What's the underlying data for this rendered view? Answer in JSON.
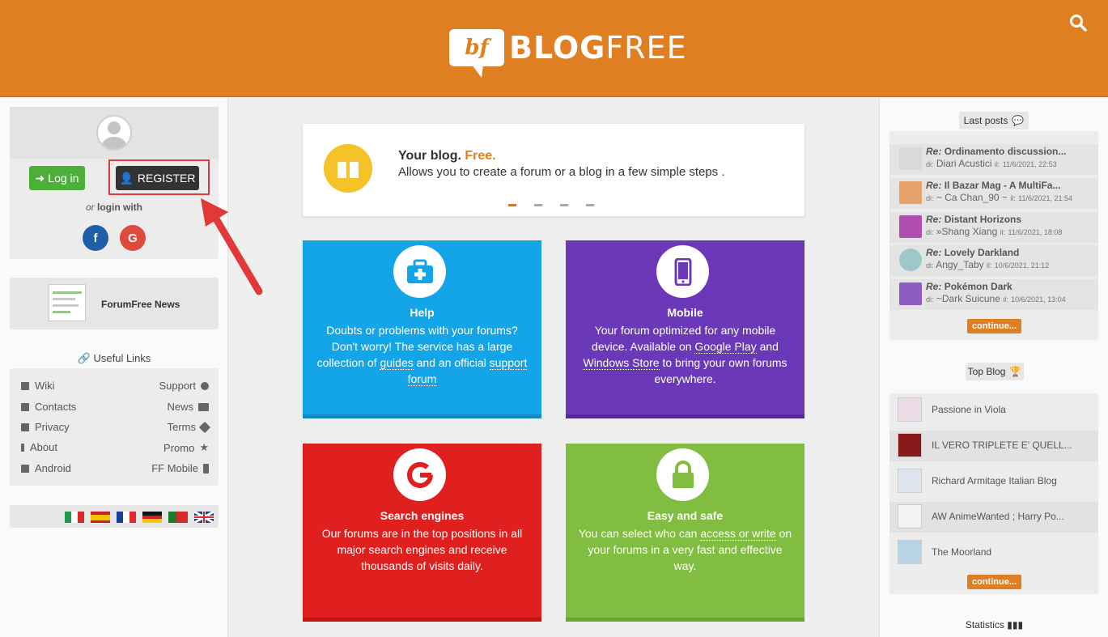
{
  "header": {
    "logo_mark": "bf",
    "logo_bold": "BLOG",
    "logo_light": "FREE",
    "search_icon": "search-icon"
  },
  "login": {
    "login_label": "Log in",
    "register_label": "REGISTER",
    "or_text": "or",
    "login_with": "login with",
    "facebook": "f",
    "google": "G"
  },
  "news": {
    "label": "ForumFree News"
  },
  "useful_links": {
    "title": "Useful Links",
    "left": [
      {
        "label": "Wiki",
        "icon": "book-icon"
      },
      {
        "label": "Contacts",
        "icon": "envelope-icon"
      },
      {
        "label": "Privacy",
        "icon": "lock-icon"
      },
      {
        "label": "About",
        "icon": "info-icon"
      },
      {
        "label": "Android",
        "icon": "android-icon"
      }
    ],
    "right": [
      {
        "label": "Support",
        "icon": "lifebuoy-icon"
      },
      {
        "label": "News",
        "icon": "newspaper-icon"
      },
      {
        "label": "Terms",
        "icon": "gavel-icon"
      },
      {
        "label": "Promo",
        "icon": "star-icon"
      },
      {
        "label": "FF Mobile",
        "icon": "mobile-icon"
      }
    ]
  },
  "hero": {
    "title": "Your blog.",
    "title_accent": "Free.",
    "subtitle": "Allows you to create a forum or a blog in a few simple steps ."
  },
  "cards": {
    "help": {
      "title": "Help",
      "t1": "Doubts or problems with your forums? Don't worry! The service has a large collection of ",
      "link1": "guides",
      "t2": " and an official ",
      "link2": "support forum"
    },
    "mobile": {
      "title": "Mobile",
      "t1": "Your forum optimized for any mobile device. Available on ",
      "link1": "Google Play",
      "t2": " and ",
      "link2": "Windows Store",
      "t3": " to bring your own forums everywhere."
    },
    "search": {
      "title": "Search engines",
      "text": "Our forums are in the top positions in all major search engines and receive thousands of visits daily."
    },
    "safe": {
      "title": "Easy and safe",
      "t1": "You can select who can ",
      "link1": "access or write",
      "t2": " on your forums in a very fast and effective way."
    }
  },
  "last_posts": {
    "title": "Last posts",
    "posts": [
      {
        "re": "Re:",
        "title": "Ordinamento discussion...",
        "by": "di:",
        "author": "Diari Acustici",
        "on": "il:",
        "date": "11/6/2021, 22:53",
        "color": "#cfcfcf"
      },
      {
        "re": "Re:",
        "title": "Il Bazar Mag - A MultiFa...",
        "by": "di:",
        "author": "~ Ca Chan_90 ~",
        "on": "il:",
        "date": "11/6/2021, 21:54",
        "color": "#e9a16a"
      },
      {
        "re": "Re:",
        "title": "Distant Horizons",
        "by": "di:",
        "author": "»Shang Xiang",
        "on": "il:",
        "date": "11/6/2021, 18:08",
        "color": "#b04fb0"
      },
      {
        "re": "Re:",
        "title": "Lovely Darkland",
        "by": "di:",
        "author": "Angy_Taby",
        "on": "il:",
        "date": "10/6/2021, 21:12",
        "color": "#9ec7c9"
      },
      {
        "re": "Re:",
        "title": "Pokémon Dark",
        "by": "di:",
        "author": "~Dark Suicune",
        "on": "il:",
        "date": "10/6/2021, 13:04",
        "color": "#8d5bc2"
      }
    ],
    "continue": "continue..."
  },
  "top_blog": {
    "title": "Top Blog",
    "blogs": [
      {
        "label": "Passione in Viola"
      },
      {
        "label": "IL VERO TRIPLETE E' QUELL..."
      },
      {
        "label": "Richard Armitage Italian Blog"
      },
      {
        "label": "AW AnimeWanted ; Harry Po..."
      },
      {
        "label": "The Moorland"
      }
    ],
    "continue": "continue..."
  },
  "statistics": {
    "title": "Statistics"
  },
  "colors": {
    "brand": "#e07f22",
    "help": "#14a4e8",
    "mobile": "#6a38b8",
    "search": "#e0201f",
    "safe": "#80bd41",
    "highlight": "#e2383a"
  }
}
